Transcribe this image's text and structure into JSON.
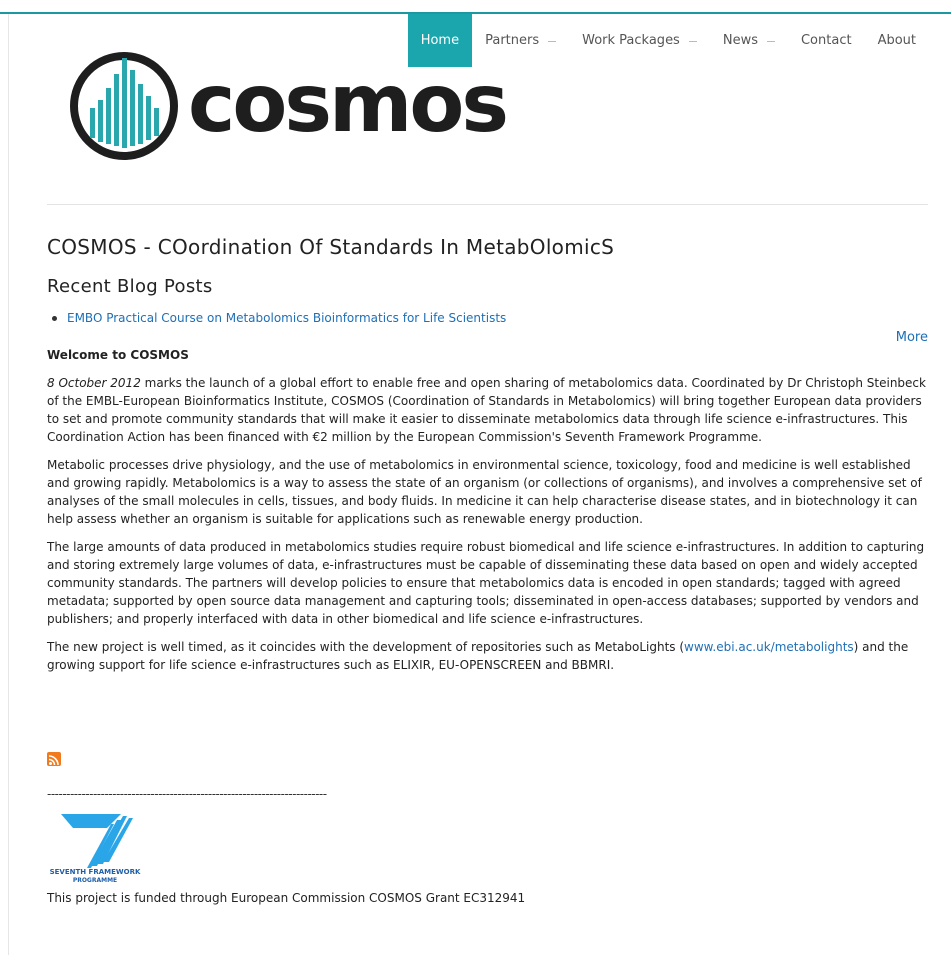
{
  "colors": {
    "accent": "#1aa6ac",
    "link": "#1e6fb6",
    "rss": "#f07a1c",
    "fp7_blue": "#2aa6e8"
  },
  "nav": {
    "items": [
      {
        "label": "Home",
        "active": true,
        "dropdown": false
      },
      {
        "label": "Partners",
        "active": false,
        "dropdown": true
      },
      {
        "label": "Work Packages",
        "active": false,
        "dropdown": true
      },
      {
        "label": "News",
        "active": false,
        "dropdown": true
      },
      {
        "label": "Contact",
        "active": false,
        "dropdown": false
      },
      {
        "label": "About",
        "active": false,
        "dropdown": false
      }
    ]
  },
  "logo": {
    "text": "cosmos",
    "icon": "cosmos-logo-icon"
  },
  "site_title": "COSMOS - COordination Of Standards In MetabOlomicS",
  "recent": {
    "heading": "Recent Blog Posts",
    "posts": [
      "EMBO Practical Course on Metabolomics Bioinformatics for Life Scientists"
    ],
    "more": "More"
  },
  "article": {
    "heading": "Welcome to COSMOS",
    "p1_date": "8 October 2012",
    "p1_rest": " marks the launch of a global effort to enable free and open sharing of metabolomics data. Coordinated by Dr Christoph Steinbeck of the EMBL-European Bioinformatics Institute, COSMOS (Coordination of Standards in Metabolomics) will bring together European data providers to set and promote community standards that will make it easier to disseminate metabolomics data through life science e-infrastructures. This Coordination Action has been financed with €2 million by the European Commission's Seventh Framework Programme.",
    "p2": "Metabolic processes drive physiology, and the use of metabolomics in environmental science, toxicology, food and medicine is well established and growing rapidly. Metabolomics is a way to assess the state of an organism (or collections of organisms), and involves a comprehensive set of analyses of the small molecules in cells, tissues, and body fluids. In medicine it can help characterise disease states, and in biotechnology it can help assess whether an organism is suitable for applications such as renewable energy production.",
    "p3": "The large amounts of data produced in metabolomics studies require robust biomedical and life science e-infrastructures. In addition to capturing and storing extremely large volumes of data, e-infrastructures must be capable of disseminating these data based on open and widely accepted community standards. The partners will develop policies to ensure that metabolomics data is encoded in open standards; tagged with agreed metadata; supported by open source data management and capturing tools; disseminated in open-access databases; supported by vendors and publishers; and properly interfaced with data in other biomedical and life science e-infrastructures.",
    "p4_before": "The new project is well timed, as it coincides with the development of repositories such as MetaboLights (",
    "p4_link": "www.ebi.ac.uk/metabolights",
    "p4_after": ") and the growing support for life science e-infrastructures such as ELIXIR, EU-OPENSCREEN and BBMRI."
  },
  "footer": {
    "rss_icon": "rss-icon",
    "divider": "-------------------------------------------------------------------------",
    "fp7_line1": "SEVENTH FRAMEWORK",
    "fp7_line2": "PROGRAMME",
    "funding": "This project is funded through European Commission COSMOS Grant EC312941"
  }
}
